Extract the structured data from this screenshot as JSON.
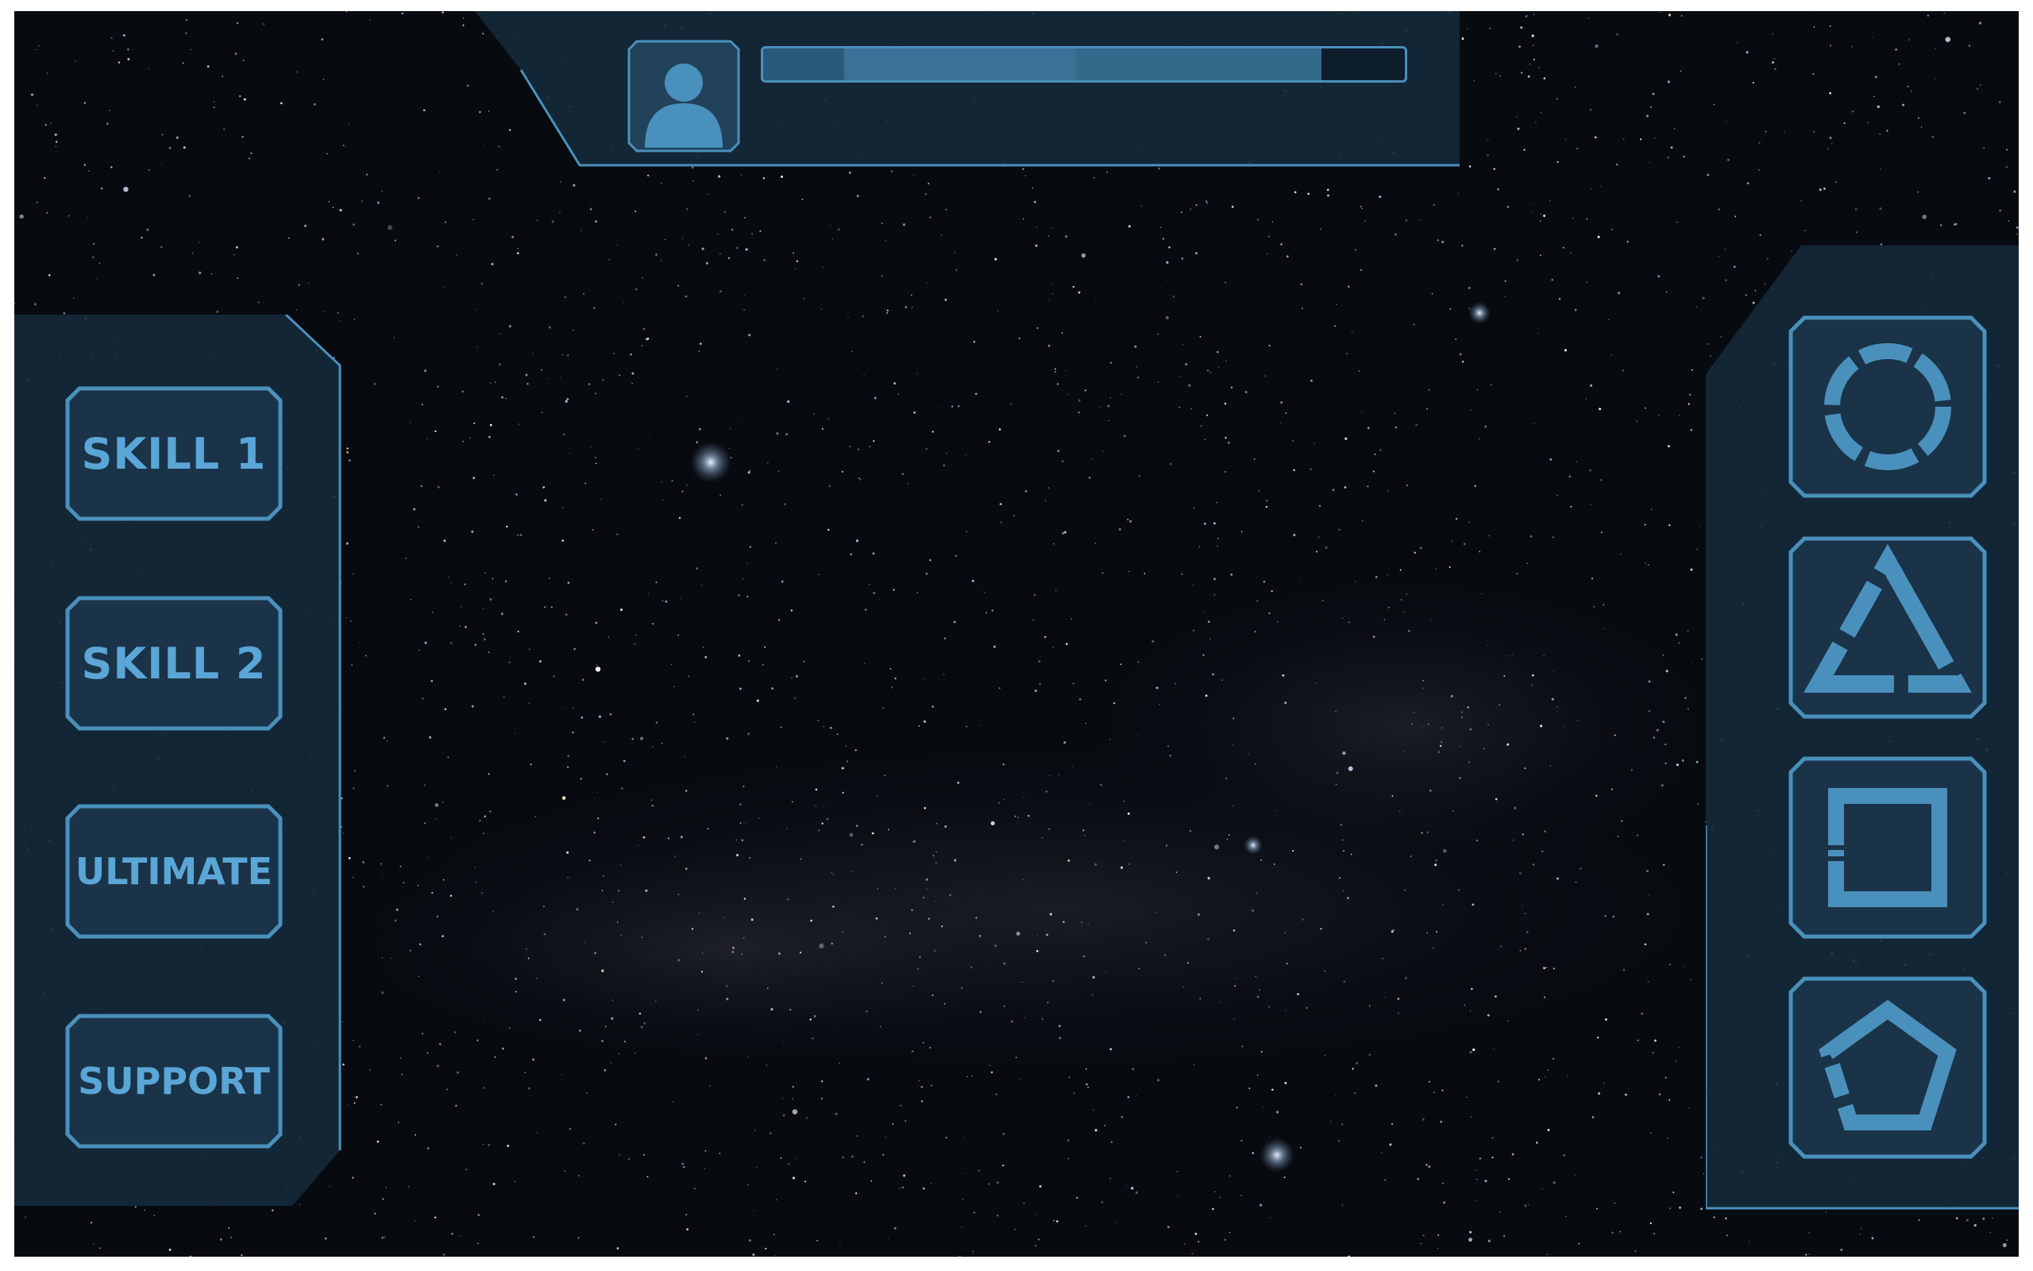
{
  "colors": {
    "accent": "#5aa6d6",
    "panel_fill": "#15293a",
    "panel_stroke": "#4a90bc",
    "bar_fill": "#3a7196",
    "space": "#070b10"
  },
  "top_hud": {
    "avatar_icon": "user-avatar-icon",
    "energy_bar_progress": 0.87
  },
  "skills": [
    {
      "label": "SKILL 1"
    },
    {
      "label": "SKILL 2"
    },
    {
      "label": "ULTIMATE"
    },
    {
      "label": "SUPPORT"
    }
  ],
  "abilities": [
    {
      "icon": "dashed-circle-icon"
    },
    {
      "icon": "broken-triangle-icon"
    },
    {
      "icon": "broken-square-icon"
    },
    {
      "icon": "broken-pentagon-icon"
    }
  ]
}
